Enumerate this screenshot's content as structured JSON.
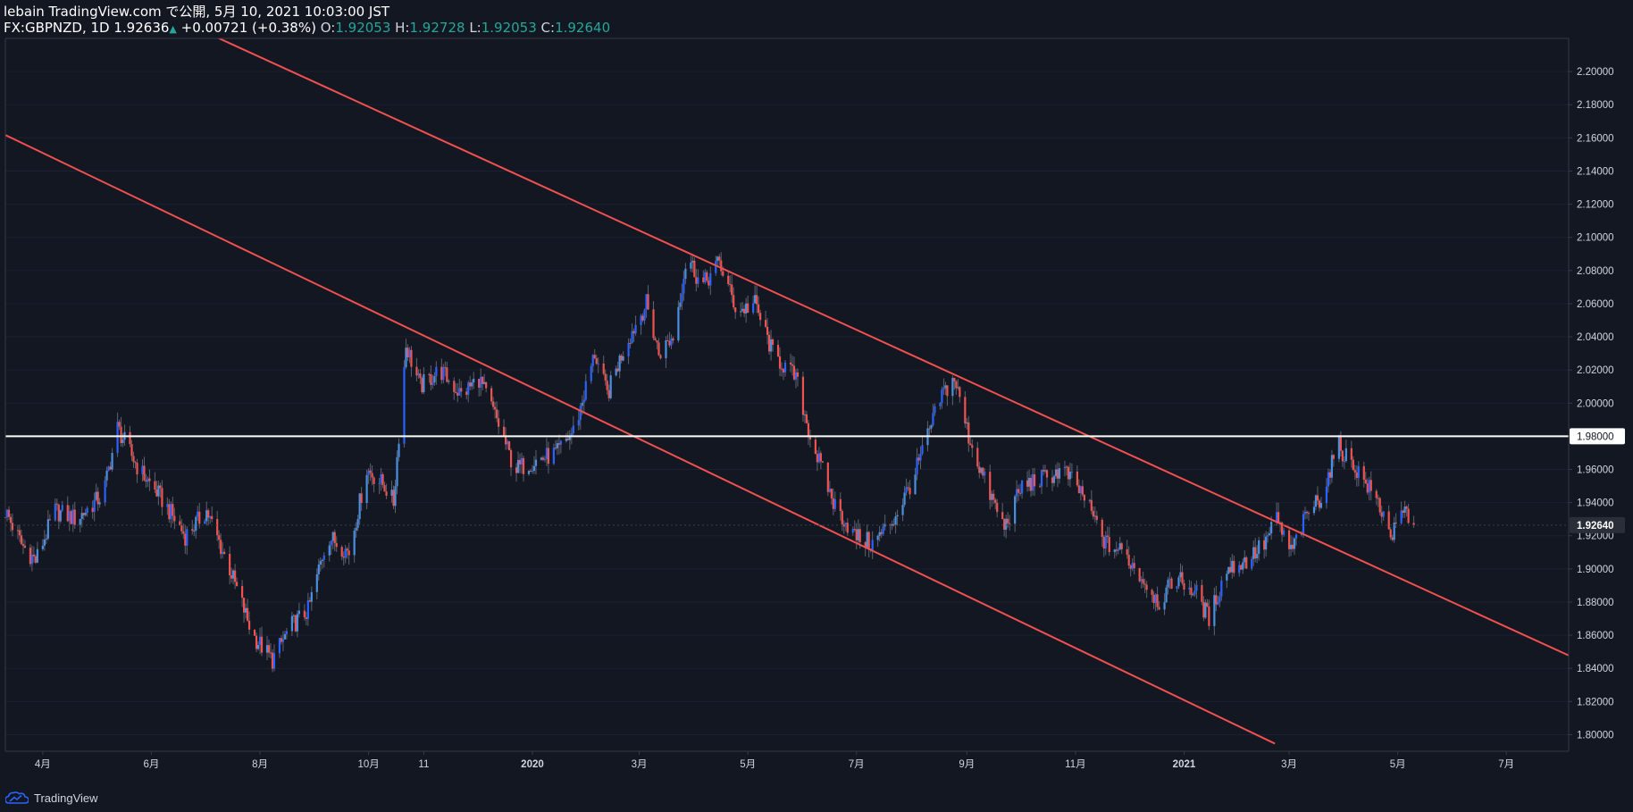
{
  "header": {
    "published_line": "lebain TradingView.com で公開, 5月 10, 2021 10:03:00 JST",
    "symbol": "FX:GBPNZD, 1D",
    "last": "1.92636",
    "change_arrow": "▲",
    "change": "+0.00721 (+0.38%)",
    "o_label": "O:",
    "o_val": "1.92053",
    "h_label": "H:",
    "h_val": "1.92728",
    "l_label": "L:",
    "l_val": "1.92053",
    "c_label": "C:",
    "c_val": "1.92640"
  },
  "footer": {
    "brand": "TradingView"
  },
  "colors": {
    "background": "#131722",
    "up": "#2962ff",
    "up_alt": "#4a90e2",
    "down": "#ef5350",
    "trendline": "#f05050",
    "level": "#ffffff",
    "axis_text": "#d1d4dc",
    "price_badge": "#2a2e39"
  },
  "chart_data": {
    "type": "candlestick",
    "symbol": "FX:GBPNZD",
    "interval": "1D",
    "ylim": [
      1.79,
      2.22
    ],
    "y_ticks": [
      "2.20000",
      "2.18000",
      "2.16000",
      "2.14000",
      "2.12000",
      "2.10000",
      "2.08000",
      "2.06000",
      "2.04000",
      "2.02000",
      "2.00000",
      "1.98000",
      "1.96000",
      "1.94000",
      "1.92000",
      "1.90000",
      "1.88000",
      "1.86000",
      "1.84000",
      "1.82000",
      "1.80000"
    ],
    "x_ticks": [
      "4月",
      "6月",
      "8月",
      "10月",
      "11",
      "2020",
      "3月",
      "5月",
      "7月",
      "9月",
      "11月",
      "2021",
      "3月",
      "5月",
      "7月"
    ],
    "x_tick_dates": [
      "2019-04-01",
      "2019-06-01",
      "2019-08-01",
      "2019-10-01",
      "2019-11-01",
      "2020-01-01",
      "2020-03-01",
      "2020-05-01",
      "2020-07-01",
      "2020-09-01",
      "2020-11-01",
      "2021-01-01",
      "2021-03-01",
      "2021-05-01",
      "2021-07-01"
    ],
    "x_range": [
      "2019-03-11",
      "2021-08-05"
    ],
    "horizontal_level": {
      "value": 1.98,
      "label": "1.98000"
    },
    "last_price": {
      "value": 1.9264,
      "label": "1.92640"
    },
    "trendlines": [
      {
        "name": "upper",
        "from": {
          "date": "2019-06-26",
          "price": 2.2264
        },
        "to": {
          "date": "2021-08-05",
          "price": 1.8478
        }
      },
      {
        "name": "lower",
        "from": {
          "date": "2019-03-11",
          "price": 2.1617
        },
        "to": {
          "date": "2021-02-21",
          "price": 1.7946
        }
      }
    ],
    "close_path": [
      [
        "2019-03-11",
        1.935
      ],
      [
        "2019-03-20",
        1.915
      ],
      [
        "2019-03-28",
        1.905
      ],
      [
        "2019-04-08",
        1.935
      ],
      [
        "2019-04-20",
        1.93
      ],
      [
        "2019-05-05",
        1.945
      ],
      [
        "2019-05-13",
        1.985
      ],
      [
        "2019-05-25",
        1.96
      ],
      [
        "2019-06-05",
        1.945
      ],
      [
        "2019-06-20",
        1.92
      ],
      [
        "2019-07-02",
        1.935
      ],
      [
        "2019-07-15",
        1.9
      ],
      [
        "2019-07-28",
        1.86
      ],
      [
        "2019-08-08",
        1.845
      ],
      [
        "2019-08-18",
        1.865
      ],
      [
        "2019-08-28",
        1.875
      ],
      [
        "2019-09-08",
        1.92
      ],
      [
        "2019-09-20",
        1.91
      ],
      [
        "2019-09-30",
        1.96
      ],
      [
        "2019-10-10",
        1.95
      ],
      [
        "2019-10-15",
        1.94
      ],
      [
        "2019-10-22",
        2.035
      ],
      [
        "2019-10-30",
        2.01
      ],
      [
        "2019-11-10",
        2.02
      ],
      [
        "2019-11-22",
        2.005
      ],
      [
        "2019-12-02",
        2.015
      ],
      [
        "2019-12-12",
        1.99
      ],
      [
        "2019-12-22",
        1.96
      ],
      [
        "2020-01-02",
        1.965
      ],
      [
        "2020-01-15",
        1.97
      ],
      [
        "2020-01-25",
        1.985
      ],
      [
        "2020-02-05",
        2.03
      ],
      [
        "2020-02-12",
        2.005
      ],
      [
        "2020-02-22",
        2.035
      ],
      [
        "2020-03-05",
        2.06
      ],
      [
        "2020-03-12",
        2.03
      ],
      [
        "2020-03-20",
        2.04
      ],
      [
        "2020-03-28",
        2.09
      ],
      [
        "2020-04-05",
        2.07
      ],
      [
        "2020-04-15",
        2.085
      ],
      [
        "2020-04-25",
        2.055
      ],
      [
        "2020-05-05",
        2.06
      ],
      [
        "2020-05-15",
        2.03
      ],
      [
        "2020-05-28",
        2.015
      ],
      [
        "2020-06-05",
        1.98
      ],
      [
        "2020-06-18",
        1.94
      ],
      [
        "2020-06-30",
        1.92
      ],
      [
        "2020-07-10",
        1.915
      ],
      [
        "2020-07-22",
        1.93
      ],
      [
        "2020-08-02",
        1.955
      ],
      [
        "2020-08-18",
        2.005
      ],
      [
        "2020-08-25",
        2.015
      ],
      [
        "2020-09-02",
        1.98
      ],
      [
        "2020-09-12",
        1.95
      ],
      [
        "2020-09-22",
        1.925
      ],
      [
        "2020-10-02",
        1.95
      ],
      [
        "2020-10-15",
        1.955
      ],
      [
        "2020-10-25",
        1.96
      ],
      [
        "2020-11-05",
        1.945
      ],
      [
        "2020-11-18",
        1.915
      ],
      [
        "2020-11-28",
        1.91
      ],
      [
        "2020-12-08",
        1.895
      ],
      [
        "2020-12-18",
        1.88
      ],
      [
        "2020-12-28",
        1.895
      ],
      [
        "2021-01-08",
        1.885
      ],
      [
        "2021-01-15",
        1.87
      ],
      [
        "2021-01-25",
        1.9
      ],
      [
        "2021-02-05",
        1.905
      ],
      [
        "2021-02-15",
        1.915
      ],
      [
        "2021-02-22",
        1.93
      ],
      [
        "2021-03-02",
        1.91
      ],
      [
        "2021-03-12",
        1.935
      ],
      [
        "2021-03-20",
        1.945
      ],
      [
        "2021-03-28",
        1.975
      ],
      [
        "2021-04-08",
        1.96
      ],
      [
        "2021-04-20",
        1.94
      ],
      [
        "2021-04-28",
        1.92
      ],
      [
        "2021-05-05",
        1.935
      ],
      [
        "2021-05-10",
        1.9264
      ]
    ]
  }
}
